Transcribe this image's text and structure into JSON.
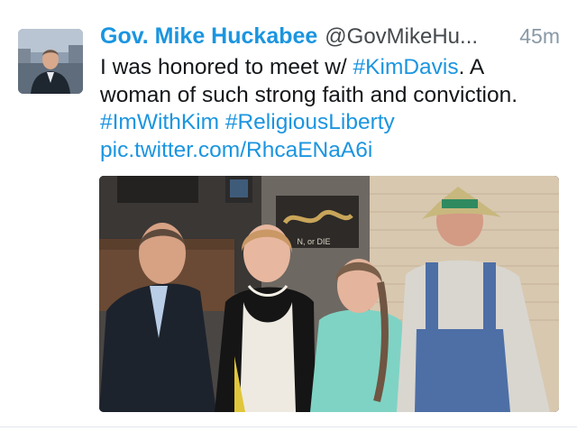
{
  "tweet": {
    "display_name": "Gov. Mike Huckabee",
    "handle": "@GovMikeHu...",
    "time": "45m",
    "text_line1_a": "I was honored to meet w/ ",
    "text_line1_hashtag": "#KimDavis",
    "text_line1_b": ". A",
    "text_line2": "woman of such strong faith and conviction.",
    "hashtag_imwithkim": "#ImWithKim",
    "hashtag_religiousliberty": "#ReligiousLiberty",
    "pic_link": "pic.twitter.com/RhcaENaA6i",
    "poster_text": "N, or DIE"
  },
  "colors": {
    "link": "#1b95e0",
    "name": "#1b95e0",
    "time": "#8899a6"
  },
  "icons": {
    "avatar": "profile-photo",
    "media": "tweet-photo"
  }
}
